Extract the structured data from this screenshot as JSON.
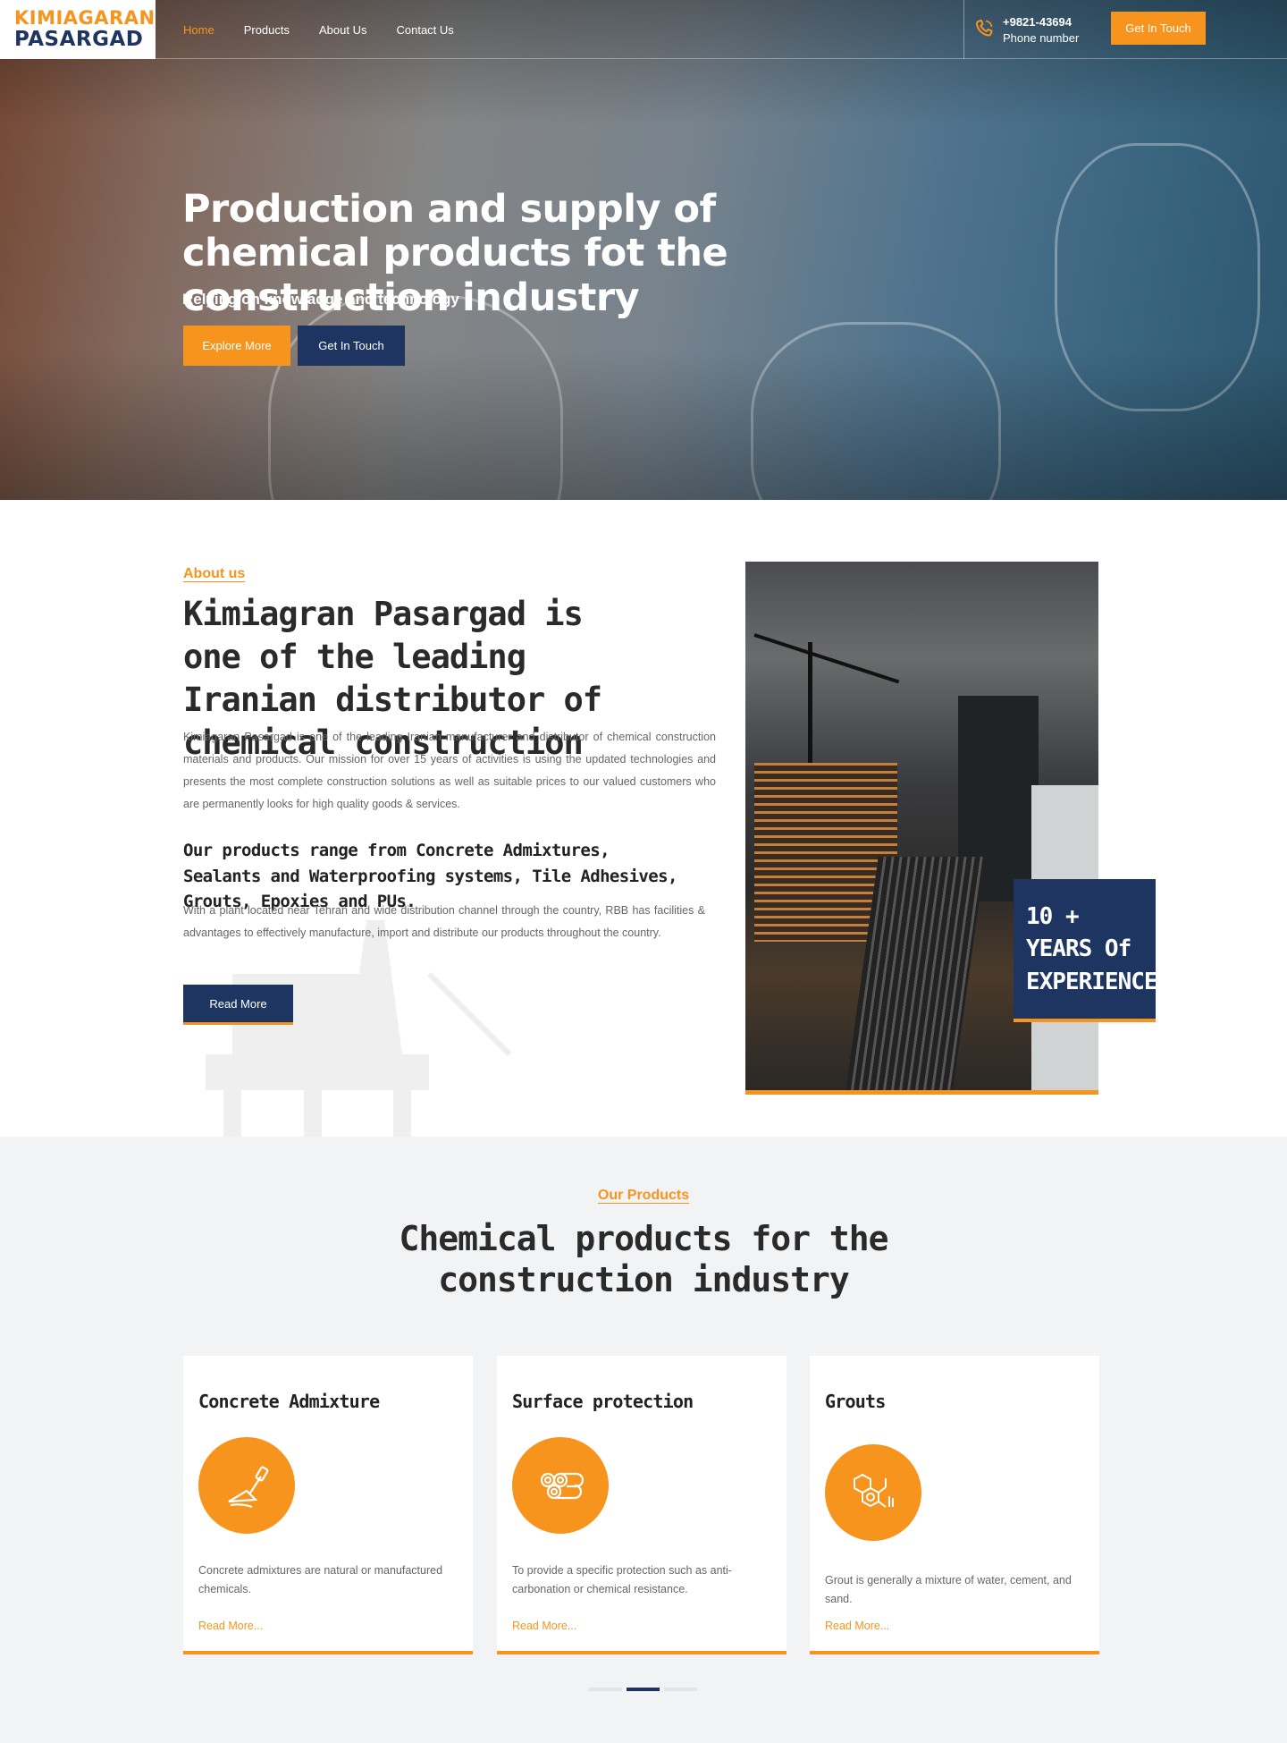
{
  "brand": {
    "line1": "KIMIAGARAN",
    "line2": "PASARGAD",
    "accent": "#f7941d",
    "navy": "#1e3461"
  },
  "nav": {
    "items": [
      "Home",
      "Products",
      "About Us",
      "Contact Us"
    ],
    "active": "Home"
  },
  "header": {
    "phone_number": "+9821-43694",
    "phone_label": "Phone number",
    "phone_icon": "phone-icon",
    "cta": "Get In Touch"
  },
  "hero": {
    "title": "Production and supply of chemical products fot the construction industry",
    "subtitle": "Relying on knowladge and technology",
    "btn_primary": "Explore More",
    "btn_secondary": "Get In Touch"
  },
  "about": {
    "eyebrow": "About us",
    "title": "Kimiagran Pasargad is one of the leading Iranian distributor of chemical construction",
    "paragraph1": "Kimiagaran Pasargad is one of the leading Iranian manufacturer and distributor of chemical construction materials and products. Our mission for over 15 years of activities is using the updated technologies and presents the most complete construction solutions as well as suitable prices to our valued customers who are permanently looks for high quality goods & services.",
    "heading2": "Our products range from Concrete Admixtures, Sealants and Waterproofing systems, Tile Adhesives, Grouts, Epoxies and PUs.",
    "paragraph2": "With a plant located near Tehran and wide distribution channel through the country, RBB has facilities & advantages to effectively manufacture, import and distribute our products throughout the country.",
    "read_more": "Read More",
    "experience": {
      "line1": "10 +",
      "line2": "YEARS Of",
      "line3": "EXPERIENCE"
    }
  },
  "products": {
    "eyebrow": "Our Products",
    "title": "Chemical products for the construction industry",
    "cards": [
      {
        "title": "Concrete Admixture",
        "icon": "trowel-icon",
        "text": "Concrete admixtures are natural or manufactured chemicals.",
        "link": "Read More..."
      },
      {
        "title": "Surface protection",
        "icon": "pipes-icon",
        "text": "To provide a specific protection such as anti-carbonation or chemical resistance.",
        "link": "Read More..."
      },
      {
        "title": "Grouts",
        "icon": "molecule-icon",
        "text": "Grout is generally a mixture of water, cement, and sand.",
        "link": "Read More..."
      }
    ],
    "pager": {
      "pages": 3,
      "active": 2
    }
  }
}
